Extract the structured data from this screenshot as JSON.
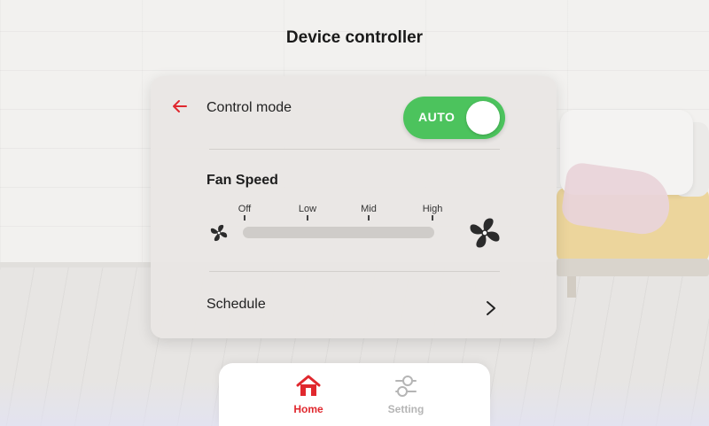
{
  "header": {
    "title": "Device controller"
  },
  "control": {
    "mode_label": "Control mode",
    "toggle_label": "AUTO",
    "toggle_on": true,
    "toggle_color": "#4cc35d"
  },
  "fan": {
    "title": "Fan Speed",
    "levels": [
      "Off",
      "Low",
      "Mid",
      "High"
    ],
    "current_level": "Off"
  },
  "schedule": {
    "label": "Schedule"
  },
  "nav": {
    "items": [
      {
        "label": "Home",
        "icon": "home-icon",
        "active": true,
        "color": "#e0282e"
      },
      {
        "label": "Setting",
        "icon": "settings-sliders-icon",
        "active": false,
        "color": "#b5b5b5"
      }
    ]
  },
  "colors": {
    "accent": "#e0282e",
    "toggle": "#4cc35d"
  }
}
